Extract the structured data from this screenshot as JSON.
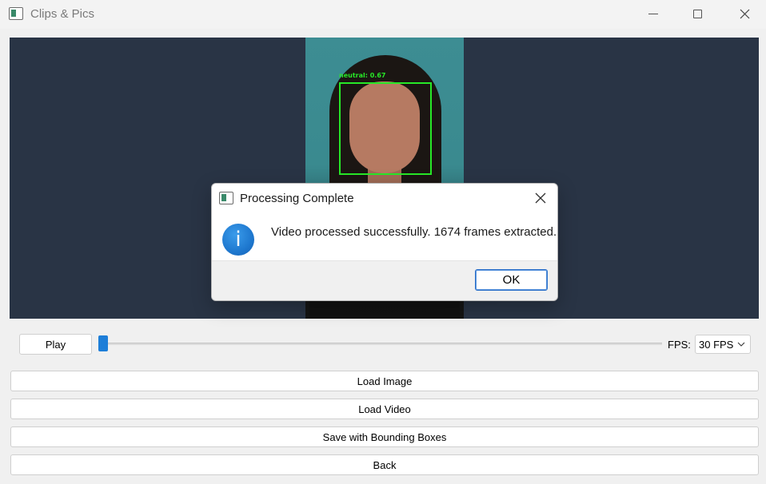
{
  "window": {
    "title": "Clips & Pics",
    "icon": "app-window-icon"
  },
  "viewer": {
    "detection_label": "neutral: 0.67",
    "bbox_color": "#27e827",
    "background_color": "#293445"
  },
  "controls": {
    "play_label": "Play",
    "slider_position": 0.0,
    "fps_label": "FPS:",
    "fps_selected": "30 FPS",
    "accent_color": "#1d7ed8"
  },
  "actions": {
    "load_image": "Load Image",
    "load_video": "Load Video",
    "save_boxes": "Save with Bounding Boxes",
    "back": "Back"
  },
  "dialog": {
    "title": "Processing Complete",
    "icon": "info-icon",
    "message": "Video processed successfully. 1674 frames extracted.",
    "ok_label": "OK"
  }
}
